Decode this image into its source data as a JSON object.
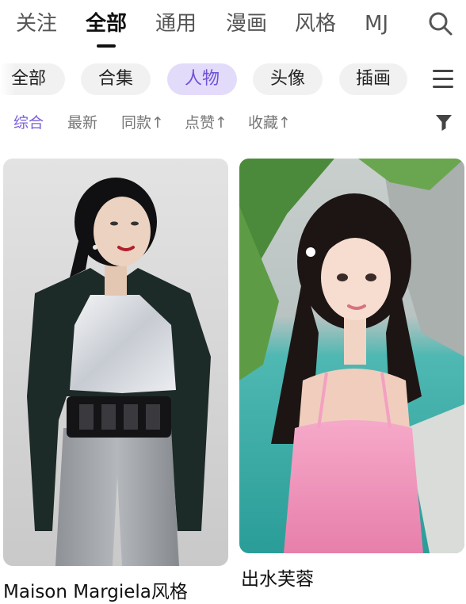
{
  "top_tabs": {
    "follow": "关注",
    "all": "全部",
    "general": "通用",
    "comic": "漫画",
    "style": "风格",
    "mj": "MJ"
  },
  "categories": {
    "all": "全部",
    "collection": "合集",
    "people": "人物",
    "avatar": "头像",
    "illustration": "插画"
  },
  "sort": {
    "overall": "综合",
    "newest": "最新",
    "same": "同款↑",
    "likes": "点赞↑",
    "favorites": "收藏↑"
  },
  "cards": [
    {
      "title": "Maison Margiela风格"
    },
    {
      "title": "出水芙蓉"
    }
  ],
  "colors": {
    "accent": "#7a5fd9",
    "active_pill_bg": "#e3dbfa",
    "pill_bg": "#f1f1f1"
  }
}
